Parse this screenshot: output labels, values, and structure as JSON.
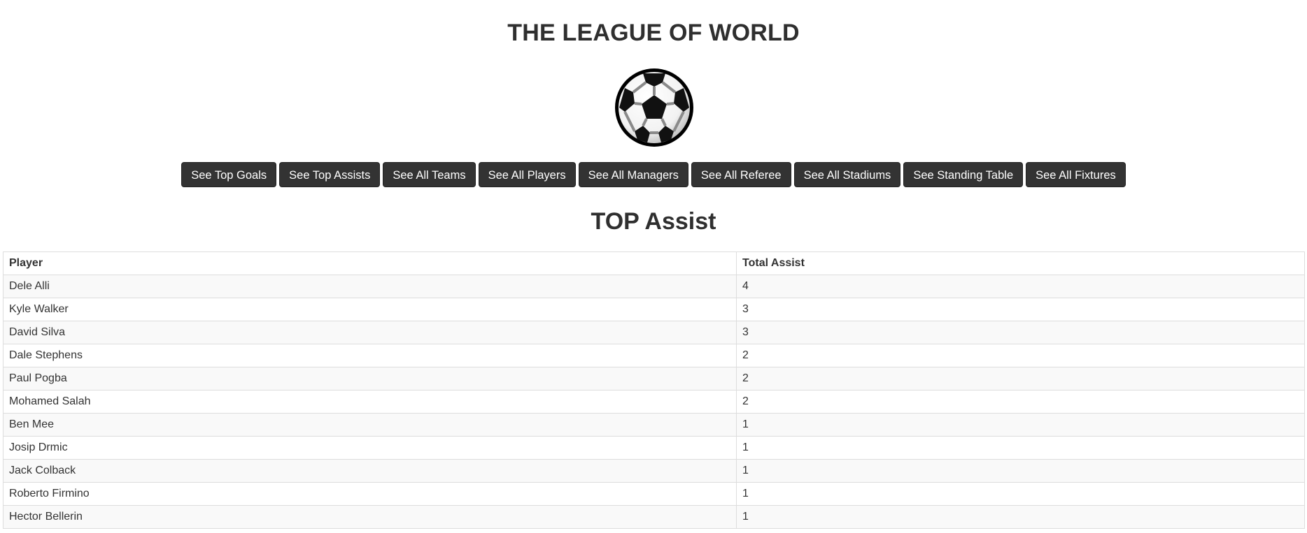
{
  "header": {
    "title": "THE LEAGUE OF WORLD",
    "logo_icon": "soccer-ball-icon"
  },
  "nav": {
    "buttons": [
      {
        "label": "See Top Goals"
      },
      {
        "label": "See Top Assists"
      },
      {
        "label": "See All Teams"
      },
      {
        "label": "See All Players"
      },
      {
        "label": "See All Managers"
      },
      {
        "label": "See All Referee"
      },
      {
        "label": "See All Stadiums"
      },
      {
        "label": "See Standing Table"
      },
      {
        "label": "See All Fixtures"
      }
    ]
  },
  "section": {
    "title": "TOP Assist"
  },
  "table": {
    "columns": [
      "Player",
      "Total Assist"
    ],
    "rows": [
      [
        "Dele Alli",
        "4"
      ],
      [
        "Kyle Walker",
        "3"
      ],
      [
        "David Silva",
        "3"
      ],
      [
        "Dale Stephens",
        "2"
      ],
      [
        "Paul Pogba",
        "2"
      ],
      [
        "Mohamed Salah",
        "2"
      ],
      [
        "Ben Mee",
        "1"
      ],
      [
        "Josip Drmic",
        "1"
      ],
      [
        "Jack Colback",
        "1"
      ],
      [
        "Roberto Firmino",
        "1"
      ],
      [
        "Hector Bellerin",
        "1"
      ]
    ]
  },
  "colors": {
    "button_bg": "#333333",
    "button_text": "#ffffff",
    "row_stripe": "#f9f9f9"
  }
}
